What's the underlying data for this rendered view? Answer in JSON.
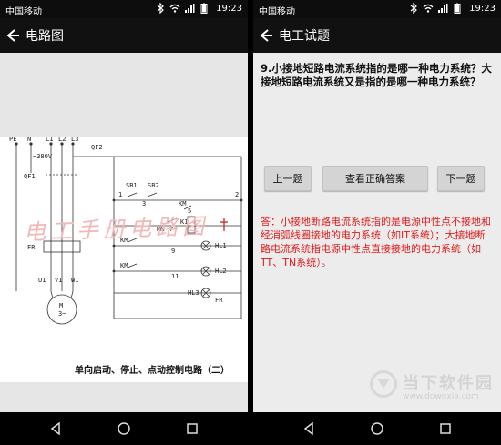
{
  "status_left": {
    "carrier": "中国移动",
    "time": "19:23"
  },
  "status_right": {
    "carrier": "中国移动",
    "time": "19:23"
  },
  "left_app": {
    "title": "电路图"
  },
  "right_app": {
    "title": "电工试题"
  },
  "diagram": {
    "watermark": "电工手册电路图",
    "caption": "单向启动、停止、点动控制电路（二）",
    "labels": {
      "pe": "PE",
      "n": "N",
      "l1": "L1",
      "l2": "L2",
      "l3": "L3",
      "v380": "~380V",
      "qf1": "QF1",
      "qf2": "QF2",
      "fr": "FR",
      "u1": "U1",
      "v1": "V1",
      "w1": "W1",
      "m": "M",
      "m3": "3~",
      "sb1": "SB1",
      "sb2": "SB2",
      "km": "KM",
      "n1": "1",
      "n2": "2",
      "n3": "3",
      "n5": "5",
      "n7": "7",
      "n9": "9",
      "n11": "11",
      "k1": "K1",
      "hl1": "HL1",
      "hl2": "HL2",
      "hl3": "HL3"
    }
  },
  "quiz": {
    "question": "9.小接地短路电流系统指的是哪一种电力系统？大接地短路电流系统又是指的是哪一种电力系统？",
    "prev_label": "上一题",
    "answer_label": "查看正确答案",
    "next_label": "下一题",
    "answer": "答：小接地断路电流系统指的是电源中性点不接地和经消弧线圈接地的电力系统（如IT系统）；大接地断路电流系统指电源中性点直接接地的电力系统（如TT、TN系统）。"
  },
  "brand": {
    "name": "当下软件园",
    "url": "www.downxia.com"
  },
  "colors": {
    "answer": "#e01b1b",
    "appbar": "#111111",
    "content_bg": "#ececec"
  }
}
